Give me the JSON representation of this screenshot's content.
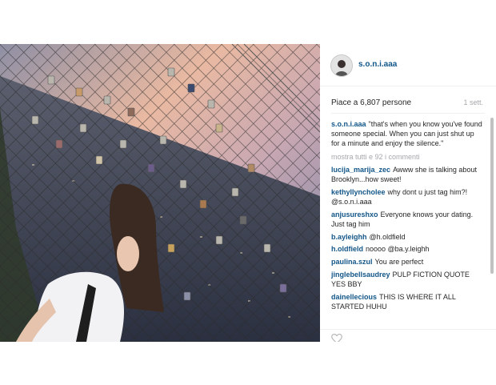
{
  "post": {
    "username": "s.o.n.i.aaa",
    "likes": "Piace a 6,807 persone",
    "time": "1 sett.",
    "caption_user": "s.o.n.i.aaa",
    "caption_text": "\"that's when you know you've found someone special. When you can just shut up for a minute and enjoy the silence.\"",
    "more_comments": "mostra tutti e 92 i commenti",
    "comment_placeholder": "",
    "accent_color": "#125688"
  },
  "comments": [
    {
      "user": "lucija_marija_zec",
      "text": "Awww she is talking about Brooklyn...how sweet!"
    },
    {
      "user": "kethyllyncholee",
      "text": "why dont u just tag him?! @s.o.n.i.aaa"
    },
    {
      "user": "anjusureshxo",
      "text": "Everyone knows your dating. Just tag him"
    },
    {
      "user": "b.ayleighh",
      "text": "@h.oldfield"
    },
    {
      "user": "h.oldfield",
      "text": "noooo @ba.y.leighh"
    },
    {
      "user": "paulina.szul",
      "text": "You are perfect"
    },
    {
      "user": "jinglebellsaudrey",
      "text": "PULP FICTION QUOTE YES BBY"
    },
    {
      "user": "dainellecious",
      "text": "THIS IS WHERE IT ALL STARTED HUHU"
    }
  ],
  "icons": {
    "like": "heart-icon",
    "avatar": "profile-photo"
  }
}
